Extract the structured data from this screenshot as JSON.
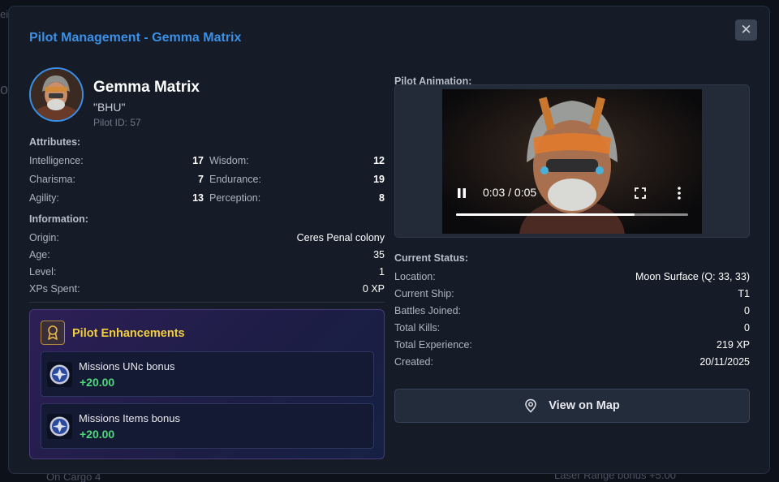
{
  "backdrop": {
    "top_left_fragment": "ei",
    "left_fragment": "o",
    "bottom_left_fragment": "On Cargo 4",
    "bottom_right_fragment": "Laser Range bonus +5.00"
  },
  "modal": {
    "title": "Pilot Management - Gemma Matrix",
    "close_label": "✕"
  },
  "pilot": {
    "name": "Gemma Matrix",
    "nickname": "\"BHU\"",
    "id_label": "Pilot ID: 57"
  },
  "attributes": {
    "label": "Attributes:",
    "items": [
      {
        "name": "Intelligence:",
        "value": "17"
      },
      {
        "name": "Wisdom:",
        "value": "12"
      },
      {
        "name": "Charisma:",
        "value": "7"
      },
      {
        "name": "Endurance:",
        "value": "19"
      },
      {
        "name": "Agility:",
        "value": "13"
      },
      {
        "name": "Perception:",
        "value": "8"
      }
    ]
  },
  "information": {
    "label": "Information:",
    "items": [
      {
        "name": "Origin:",
        "value": "Ceres Penal colony"
      },
      {
        "name": "Age:",
        "value": "35"
      },
      {
        "name": "Level:",
        "value": "1"
      },
      {
        "name": "XPs Spent:",
        "value": "0 XP"
      }
    ]
  },
  "enhancements": {
    "title": "Pilot Enhancements",
    "items": [
      {
        "name": "Missions UNc bonus",
        "value": "+20.00"
      },
      {
        "name": "Missions Items bonus",
        "value": "+20.00"
      }
    ]
  },
  "animation": {
    "label": "Pilot Animation:",
    "time": "0:03 / 0:05",
    "progress": 0.77
  },
  "status": {
    "label": "Current Status:",
    "items": [
      {
        "name": "Location:",
        "value": "Moon Surface (Q: 33, 33)"
      },
      {
        "name": "Current Ship:",
        "value": "T1"
      },
      {
        "name": "Battles Joined:",
        "value": "0"
      },
      {
        "name": "Total Kills:",
        "value": "0"
      },
      {
        "name": "Total Experience:",
        "value": "219 XP"
      },
      {
        "name": "Created:",
        "value": "20/11/2025"
      }
    ]
  },
  "map_button": {
    "label": "View on Map"
  },
  "colors": {
    "accent": "#3b8fe6",
    "gold": "#f2cf3c",
    "bonus_green": "#4bd97a"
  }
}
